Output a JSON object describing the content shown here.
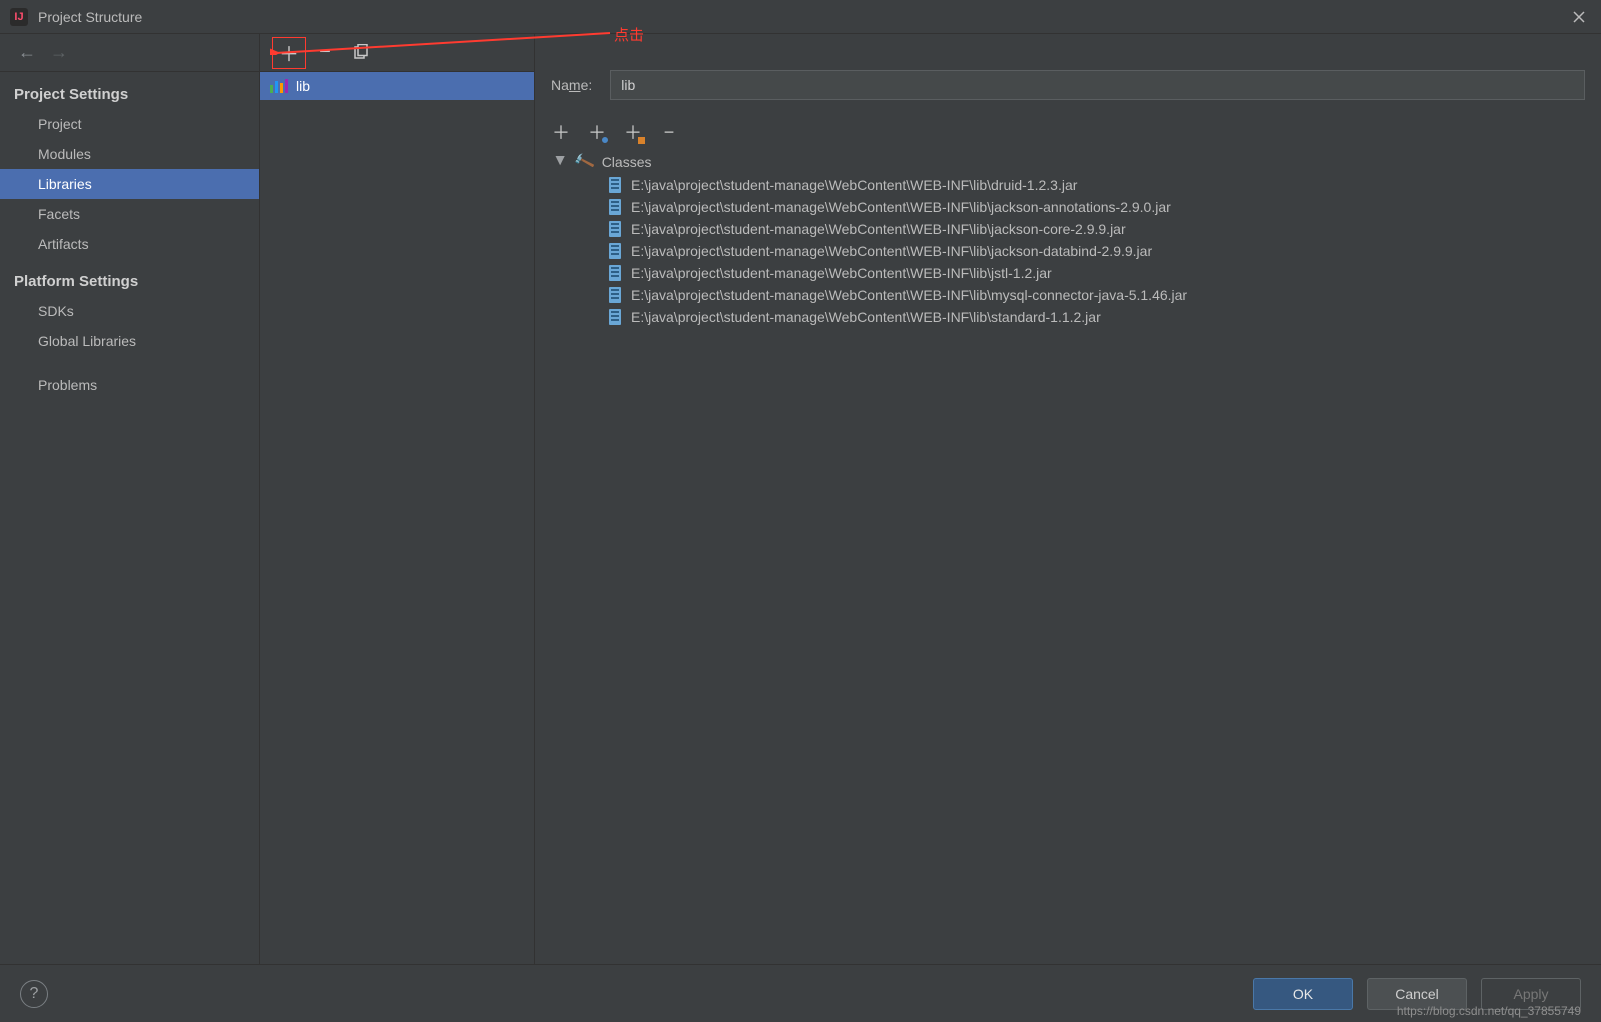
{
  "window": {
    "title": "Project Structure"
  },
  "annotation": {
    "label": "点击"
  },
  "nav": {
    "section1_title": "Project Settings",
    "section1_items": [
      "Project",
      "Modules",
      "Libraries",
      "Facets",
      "Artifacts"
    ],
    "section1_selected_index": 2,
    "section2_title": "Platform Settings",
    "section2_items": [
      "SDKs",
      "Global Libraries"
    ],
    "extra_items": [
      "Problems"
    ]
  },
  "libraries_list": {
    "items": [
      {
        "name": "lib"
      }
    ],
    "selected_index": 0
  },
  "detail": {
    "name_label_prefix": "Na",
    "name_label_underlined": "m",
    "name_label_suffix": "e:",
    "name_value": "lib",
    "tree_root": "Classes",
    "jars": [
      "E:\\java\\project\\student-manage\\WebContent\\WEB-INF\\lib\\druid-1.2.3.jar",
      "E:\\java\\project\\student-manage\\WebContent\\WEB-INF\\lib\\jackson-annotations-2.9.0.jar",
      "E:\\java\\project\\student-manage\\WebContent\\WEB-INF\\lib\\jackson-core-2.9.9.jar",
      "E:\\java\\project\\student-manage\\WebContent\\WEB-INF\\lib\\jackson-databind-2.9.9.jar",
      "E:\\java\\project\\student-manage\\WebContent\\WEB-INF\\lib\\jstl-1.2.jar",
      "E:\\java\\project\\student-manage\\WebContent\\WEB-INF\\lib\\mysql-connector-java-5.1.46.jar",
      "E:\\java\\project\\student-manage\\WebContent\\WEB-INF\\lib\\standard-1.1.2.jar"
    ]
  },
  "footer": {
    "ok": "OK",
    "cancel": "Cancel",
    "apply": "Apply"
  },
  "watermark": "https://blog.csdn.net/qq_37855749"
}
